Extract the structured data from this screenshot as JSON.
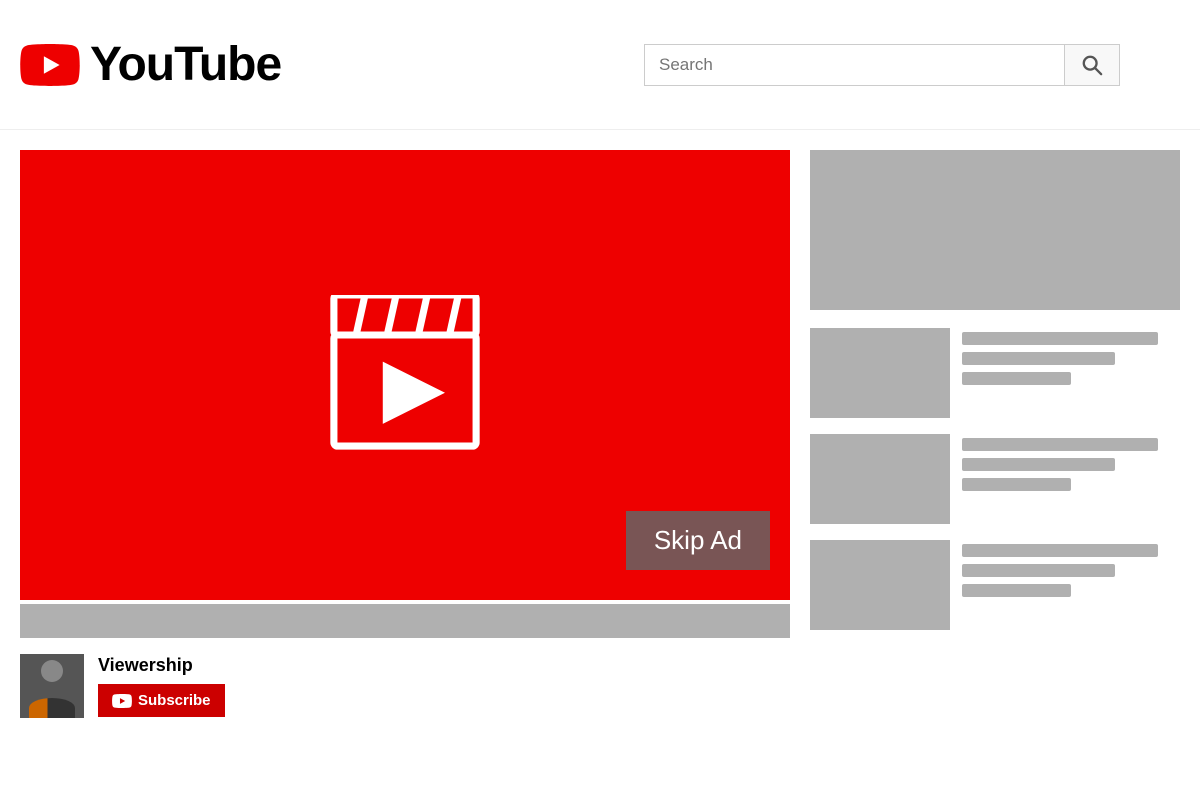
{
  "header": {
    "logo_text": "YouTube",
    "search_placeholder": "Search"
  },
  "video": {
    "skip_ad_label": "Skip Ad",
    "channel_name": "Viewership",
    "subscribe_label": "Subscribe"
  },
  "sidebar": {
    "recommended": [
      {
        "id": 1
      },
      {
        "id": 2
      },
      {
        "id": 3
      }
    ]
  }
}
